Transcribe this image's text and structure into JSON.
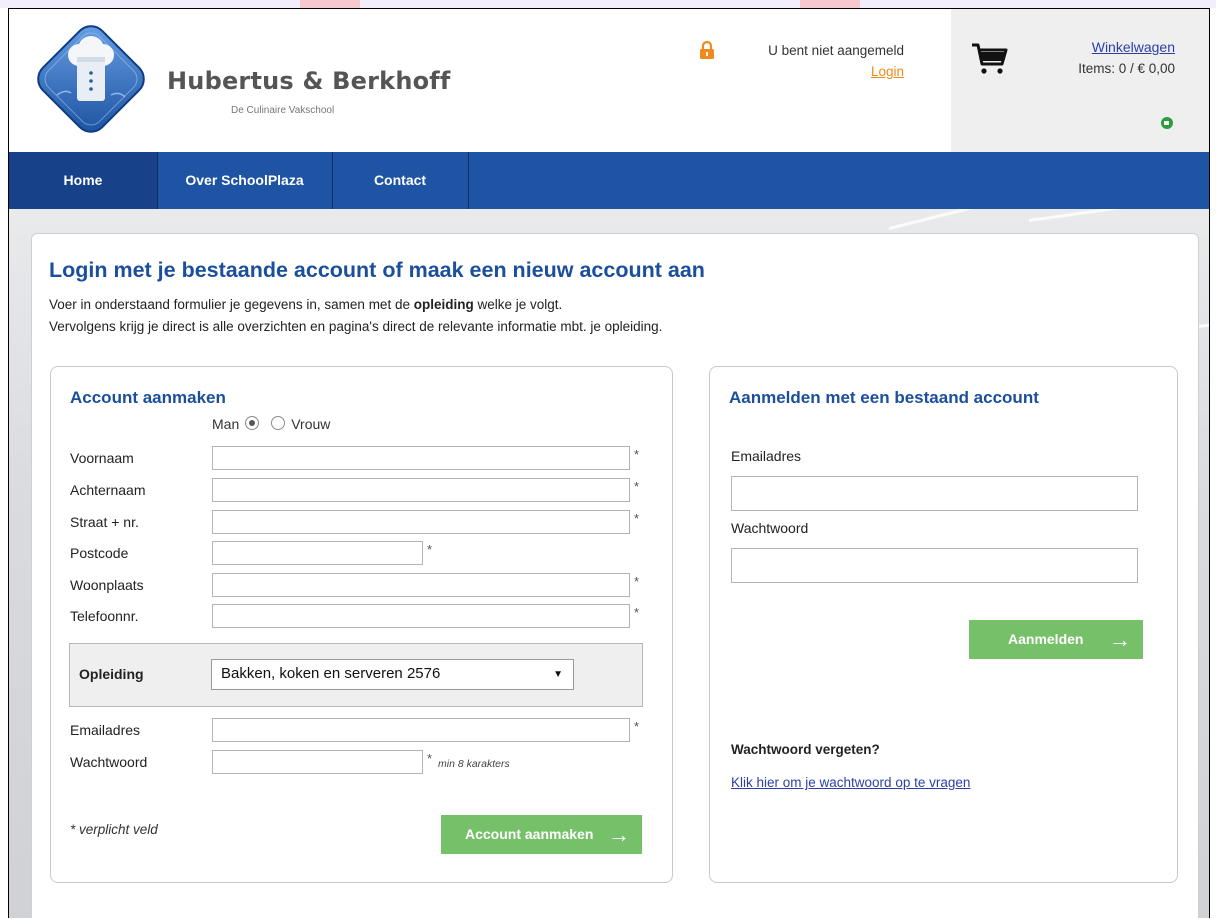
{
  "brand": {
    "name": "Hubertus & Berkhoff",
    "subtitle": "De Culinaire Vakschool",
    "logo_icon": "chef-hat-logo"
  },
  "account": {
    "status": "U bent niet aangemeld",
    "login_label": "Login",
    "lock_icon": "lock-icon"
  },
  "cart": {
    "link_label": "Winkelwagen",
    "items_text": "Items: 0 / € 0,00",
    "icon": "cart-icon"
  },
  "nav": {
    "items": [
      {
        "label": "Home"
      },
      {
        "label": "Over SchoolPlaza"
      },
      {
        "label": "Contact"
      }
    ]
  },
  "page": {
    "title": "Login met je bestaande account of maak een nieuw account aan",
    "intro_line1_pre": "Voer in onderstaand formulier je gegevens in, samen met de ",
    "intro_line1_bold": "opleiding",
    "intro_line1_post": " welke je volgt.",
    "intro_line2": "Vervolgens krijg je direct is alle overzichten en pagina's direct de relevante informatie mbt. je opleiding."
  },
  "register": {
    "title": "Account aanmaken",
    "gender_male": "Man",
    "gender_female": "Vrouw",
    "gender_selected": "Man",
    "fields": [
      {
        "label": "Voornaam",
        "value": "",
        "required": "*"
      },
      {
        "label": "Achternaam",
        "value": "",
        "required": "*"
      },
      {
        "label": "Straat + nr.",
        "value": "",
        "required": "*"
      },
      {
        "label": "Postcode",
        "value": "",
        "required": "*"
      },
      {
        "label": "Woonplaats",
        "value": "",
        "required": "*"
      },
      {
        "label": "Telefoonnr.",
        "value": "",
        "required": "*"
      }
    ],
    "opleiding_label": "Opleiding",
    "opleiding_selected": "Bakken, koken en serveren 2576",
    "email_label": "Emailadres",
    "email_value": "",
    "email_required": "*",
    "password_label": "Wachtwoord",
    "password_value": "",
    "password_required": "*",
    "password_hint": "min 8 karakters",
    "required_note": "* verplicht veld",
    "submit_label": "Account aanmaken",
    "arrow": "→"
  },
  "login": {
    "title": "Aanmelden met een bestaand account",
    "email_label": "Emailadres",
    "email_value": "",
    "password_label": "Wachtwoord",
    "password_value": "",
    "submit_label": "Aanmelden",
    "arrow": "→",
    "forgot_title": "Wachtwoord vergeten?",
    "forgot_link": "Klik hier om je wachtwoord op te vragen"
  },
  "colors": {
    "nav_blue": "#1f53a3",
    "title_blue": "#1b4f9c",
    "button_green": "#77c06a",
    "login_orange": "#f08a1c"
  }
}
